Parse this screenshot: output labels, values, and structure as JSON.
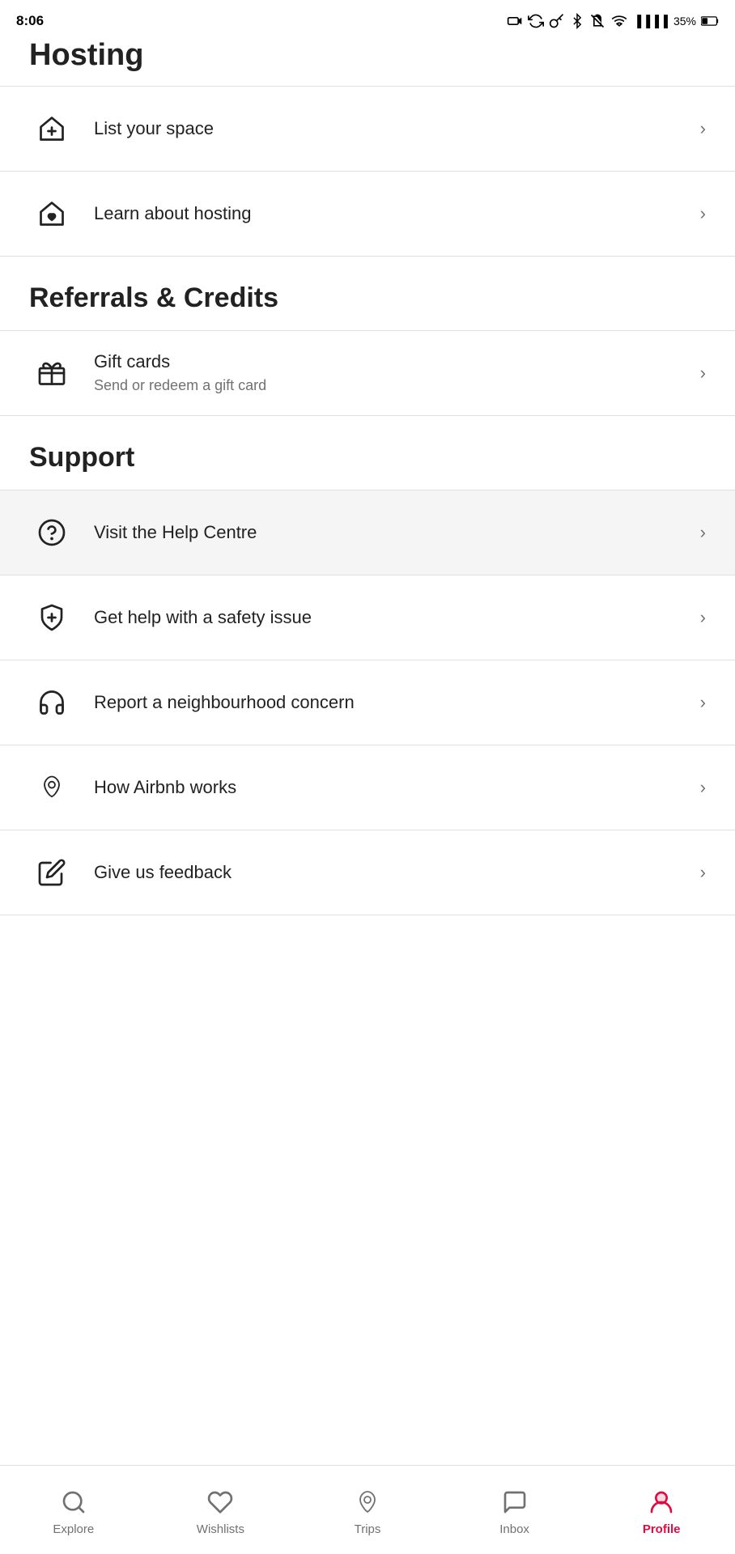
{
  "statusBar": {
    "time": "8:06",
    "battery": "35%"
  },
  "partialHeader": {
    "title": "Hosting"
  },
  "hostingSection": {
    "items": [
      {
        "id": "list-space",
        "label": "List your space",
        "subtitle": "",
        "icon": "house-plus-icon"
      },
      {
        "id": "learn-hosting",
        "label": "Learn about hosting",
        "subtitle": "",
        "icon": "house-heart-icon"
      }
    ]
  },
  "referralsSection": {
    "title": "Referrals & Credits",
    "items": [
      {
        "id": "gift-cards",
        "label": "Gift cards",
        "subtitle": "Send or redeem a gift card",
        "icon": "gift-icon"
      }
    ]
  },
  "supportSection": {
    "title": "Support",
    "items": [
      {
        "id": "help-centre",
        "label": "Visit the Help Centre",
        "subtitle": "",
        "icon": "help-circle-icon",
        "highlighted": true
      },
      {
        "id": "safety-issue",
        "label": "Get help with a safety issue",
        "subtitle": "",
        "icon": "shield-plus-icon",
        "highlighted": false
      },
      {
        "id": "neighbourhood-concern",
        "label": "Report a neighbourhood concern",
        "subtitle": "",
        "icon": "headset-icon",
        "highlighted": false
      },
      {
        "id": "how-airbnb-works",
        "label": "How Airbnb works",
        "subtitle": "",
        "icon": "airbnb-icon",
        "highlighted": false
      },
      {
        "id": "give-feedback",
        "label": "Give us feedback",
        "subtitle": "",
        "icon": "pencil-icon",
        "highlighted": false
      }
    ]
  },
  "bottomNav": {
    "items": [
      {
        "id": "explore",
        "label": "Explore",
        "icon": "search-icon",
        "active": false
      },
      {
        "id": "wishlists",
        "label": "Wishlists",
        "icon": "heart-icon",
        "active": false
      },
      {
        "id": "trips",
        "label": "Trips",
        "icon": "airbnb-nav-icon",
        "active": false
      },
      {
        "id": "inbox",
        "label": "Inbox",
        "icon": "chat-icon",
        "active": false
      },
      {
        "id": "profile",
        "label": "Profile",
        "icon": "profile-icon",
        "active": true
      }
    ]
  },
  "androidNav": {
    "items": [
      "menu-icon",
      "home-icon",
      "back-icon"
    ]
  }
}
